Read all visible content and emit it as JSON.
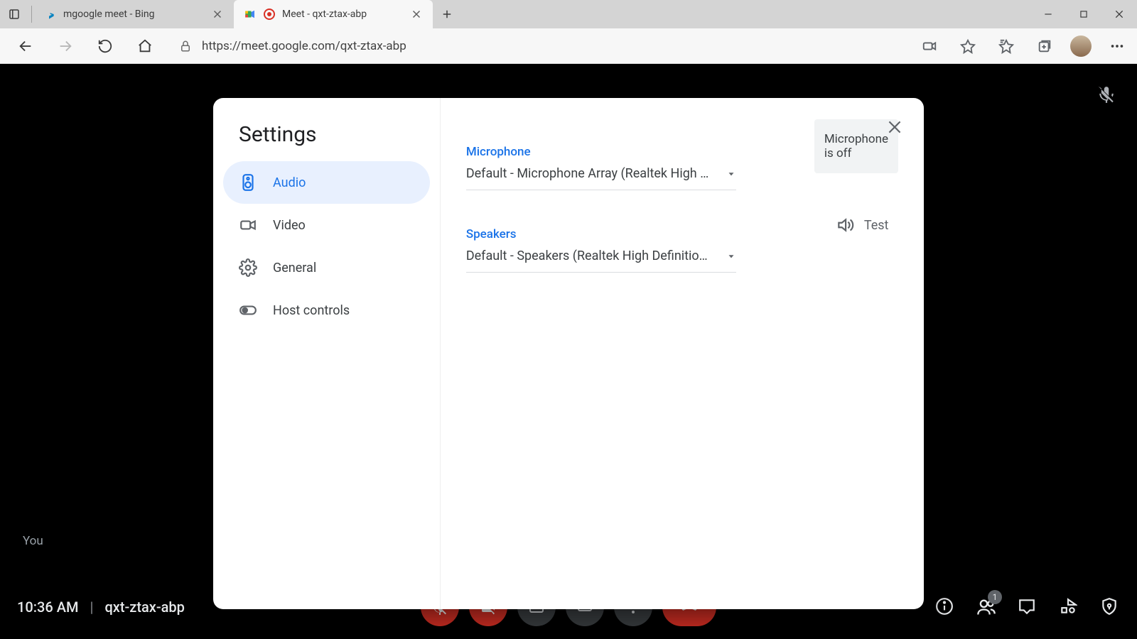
{
  "browser": {
    "tab1": "mgoogle meet - Bing",
    "tab2": "Meet - qxt-ztax-abp",
    "url": "https://meet.google.com/qxt-ztax-abp"
  },
  "meet": {
    "you": "You",
    "clock": "10:36 AM",
    "code": "qxt-ztax-abp",
    "participants_badge": "1"
  },
  "settings": {
    "title": "Settings",
    "nav": {
      "audio": "Audio",
      "video": "Video",
      "general": "General",
      "host": "Host controls"
    },
    "mic": {
      "label": "Microphone",
      "value": "Default - Microphone Array (Realtek High …",
      "status": "Microphone is off"
    },
    "spk": {
      "label": "Speakers",
      "value": "Default - Speakers (Realtek High Definitio…",
      "test": "Test"
    }
  }
}
